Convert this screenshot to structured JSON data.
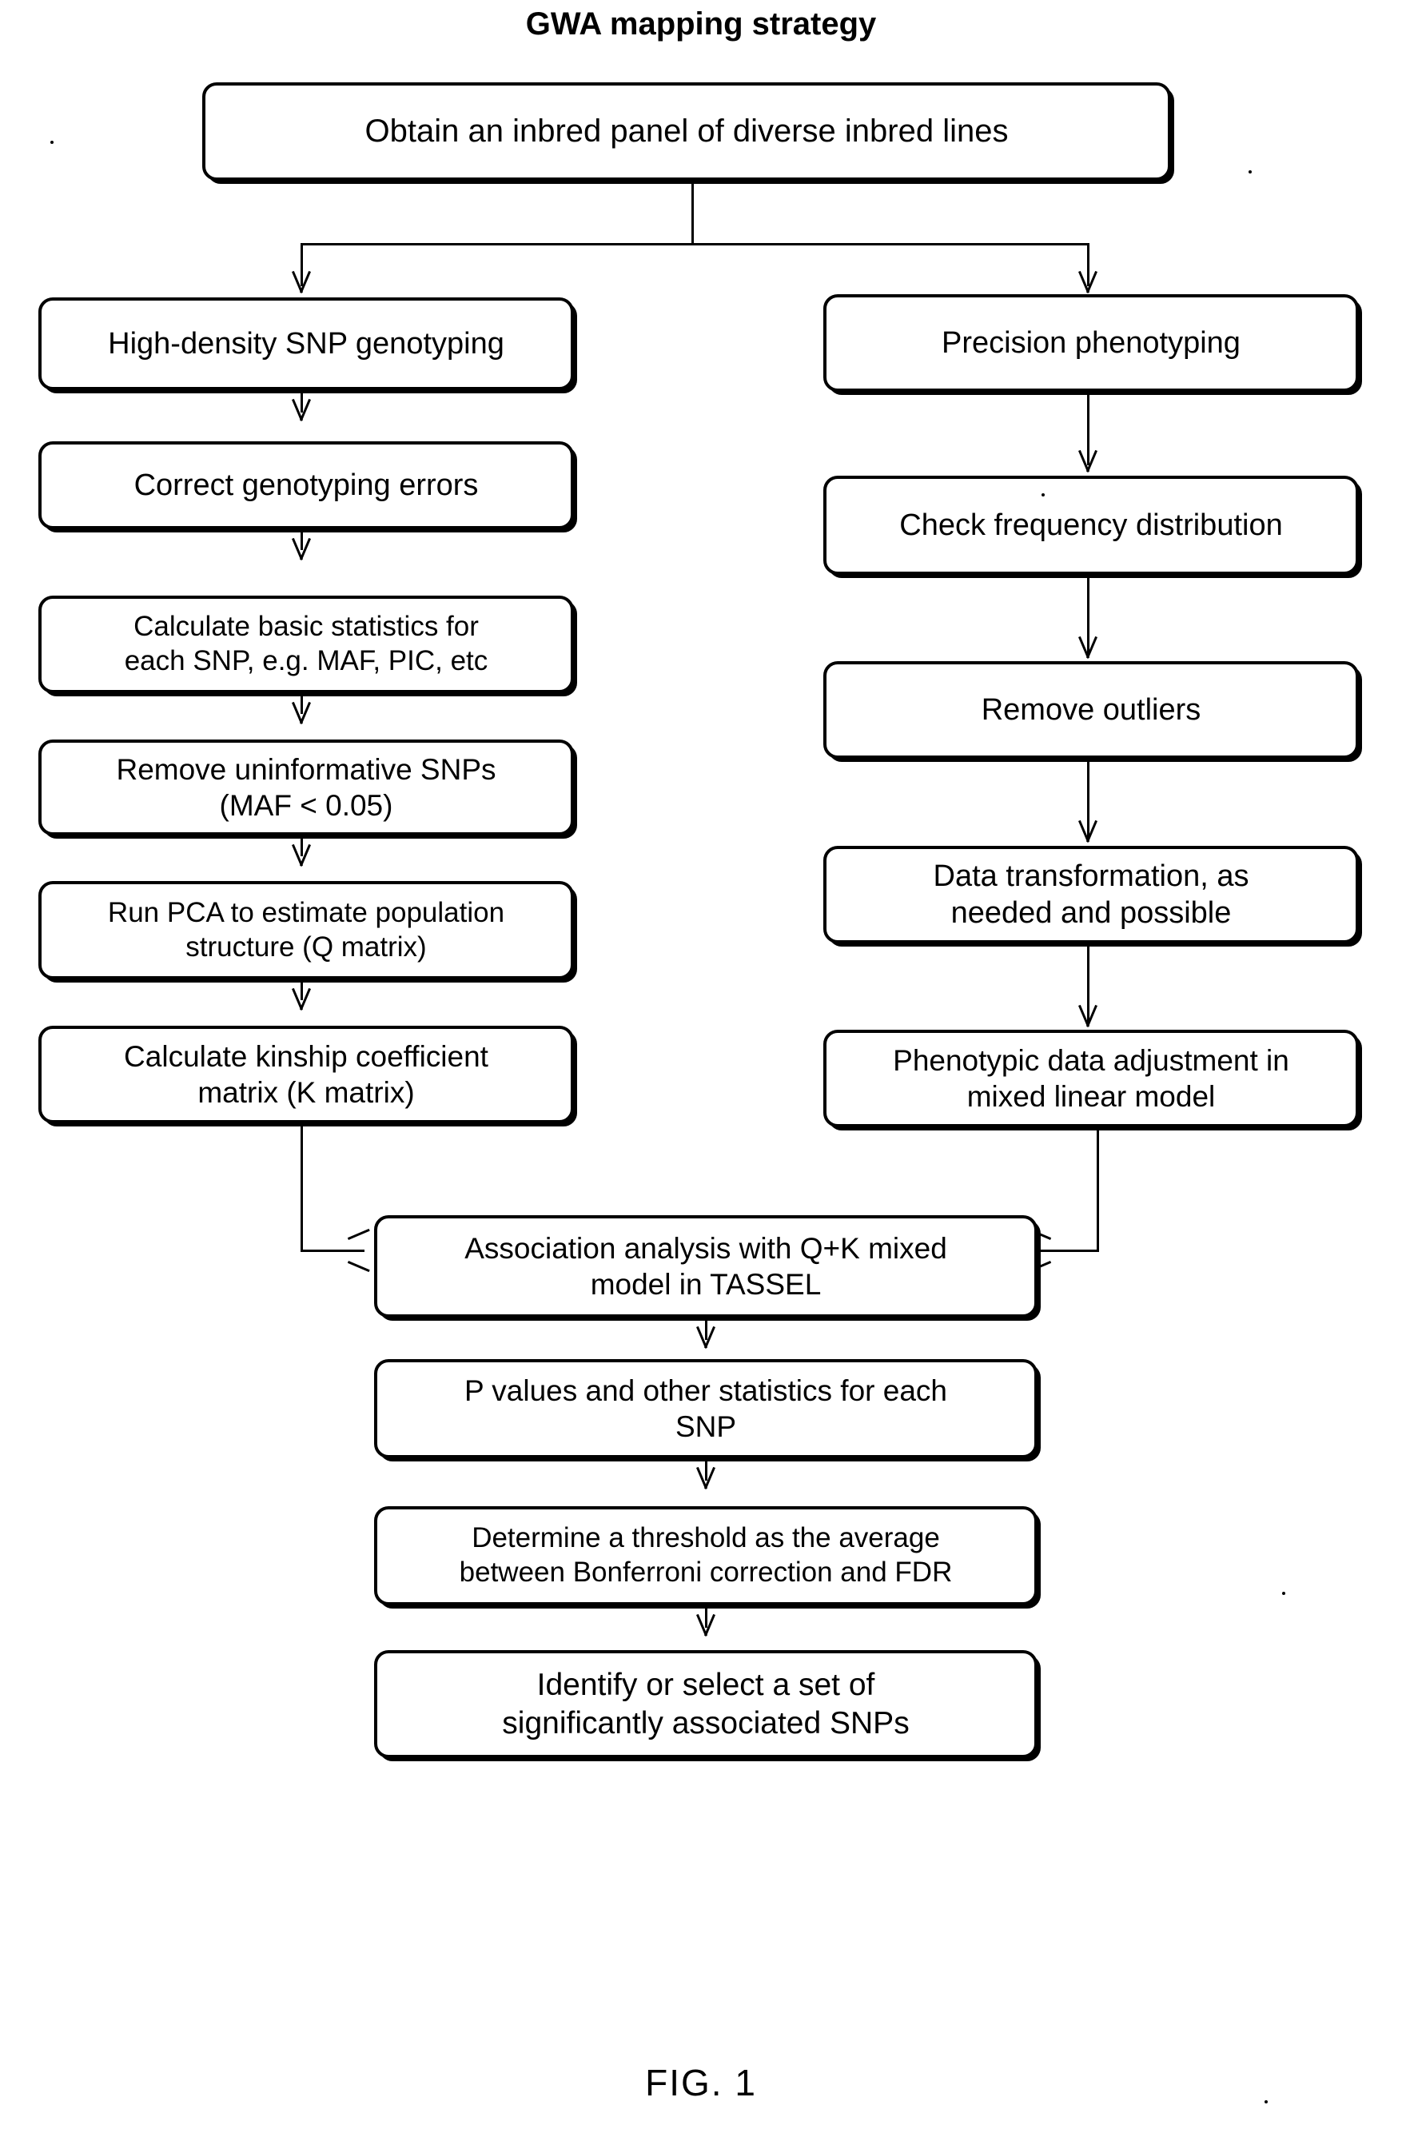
{
  "figure": {
    "title": "GWA mapping strategy",
    "caption": "FIG. 1"
  },
  "flowchart": {
    "type": "flowchart",
    "orientation": "top-down",
    "nodes": {
      "start": {
        "id": "obtain-panel",
        "label": "Obtain an inbred panel of diverse inbred lines"
      },
      "genotype_branch": [
        {
          "id": "snp-genotyping",
          "label": "High-density SNP genotyping"
        },
        {
          "id": "correct-errors",
          "label": "Correct genotyping errors"
        },
        {
          "id": "basic-statistics",
          "label": "Calculate  basic statistics for\neach SNP, e.g. MAF, PIC, etc"
        },
        {
          "id": "remove-uninformative",
          "label": "Remove uninformative SNPs\n(MAF < 0.05)"
        },
        {
          "id": "run-pca",
          "label": "Run PCA to estimate population\nstructure (Q matrix)"
        },
        {
          "id": "kinship-matrix",
          "label": "Calculate kinship coefficient\nmatrix (K matrix)"
        }
      ],
      "phenotype_branch": [
        {
          "id": "precision-phenotyping",
          "label": "Precision phenotyping"
        },
        {
          "id": "check-frequency",
          "label": "Check frequency distribution"
        },
        {
          "id": "remove-outliers",
          "label": "Remove outliers"
        },
        {
          "id": "data-transformation",
          "label": "Data transformation, as\nneeded and possible"
        },
        {
          "id": "phenotypic-adjustment",
          "label": "Phenotypic data adjustment in\nmixed linear model"
        }
      ],
      "merged": [
        {
          "id": "association-analysis",
          "label": "Association analysis with Q+K mixed\nmodel in TASSEL"
        },
        {
          "id": "p-values",
          "label": "P values and other statistics for each\nSNP"
        },
        {
          "id": "determine-threshold",
          "label": "Determine a threshold as the average\nbetween Bonferroni correction and FDR"
        },
        {
          "id": "identify-snps",
          "label": "Identify or select a set of\nsignificantly associated SNPs"
        }
      ]
    },
    "edges": [
      {
        "from": "obtain-panel",
        "to": "snp-genotyping",
        "style": "split-arrow"
      },
      {
        "from": "obtain-panel",
        "to": "precision-phenotyping",
        "style": "split-arrow"
      },
      {
        "from": "snp-genotyping",
        "to": "correct-errors",
        "style": "arrow-down"
      },
      {
        "from": "correct-errors",
        "to": "basic-statistics",
        "style": "arrow-down"
      },
      {
        "from": "basic-statistics",
        "to": "remove-uninformative",
        "style": "arrow-down"
      },
      {
        "from": "remove-uninformative",
        "to": "run-pca",
        "style": "arrow-down"
      },
      {
        "from": "run-pca",
        "to": "kinship-matrix",
        "style": "arrow-down"
      },
      {
        "from": "precision-phenotyping",
        "to": "check-frequency",
        "style": "arrow-down"
      },
      {
        "from": "check-frequency",
        "to": "remove-outliers",
        "style": "arrow-down"
      },
      {
        "from": "remove-outliers",
        "to": "data-transformation",
        "style": "arrow-down"
      },
      {
        "from": "data-transformation",
        "to": "phenotypic-adjustment",
        "style": "arrow-down"
      },
      {
        "from": "kinship-matrix",
        "to": "association-analysis",
        "style": "elbow-arrow-right"
      },
      {
        "from": "phenotypic-adjustment",
        "to": "association-analysis",
        "style": "elbow-arrow-left"
      },
      {
        "from": "association-analysis",
        "to": "p-values",
        "style": "arrow-down"
      },
      {
        "from": "p-values",
        "to": "determine-threshold",
        "style": "arrow-down"
      },
      {
        "from": "determine-threshold",
        "to": "identify-snps",
        "style": "arrow-down"
      }
    ],
    "colors": {
      "stroke": "#000000",
      "fill": "#ffffff",
      "text": "#000000"
    }
  }
}
